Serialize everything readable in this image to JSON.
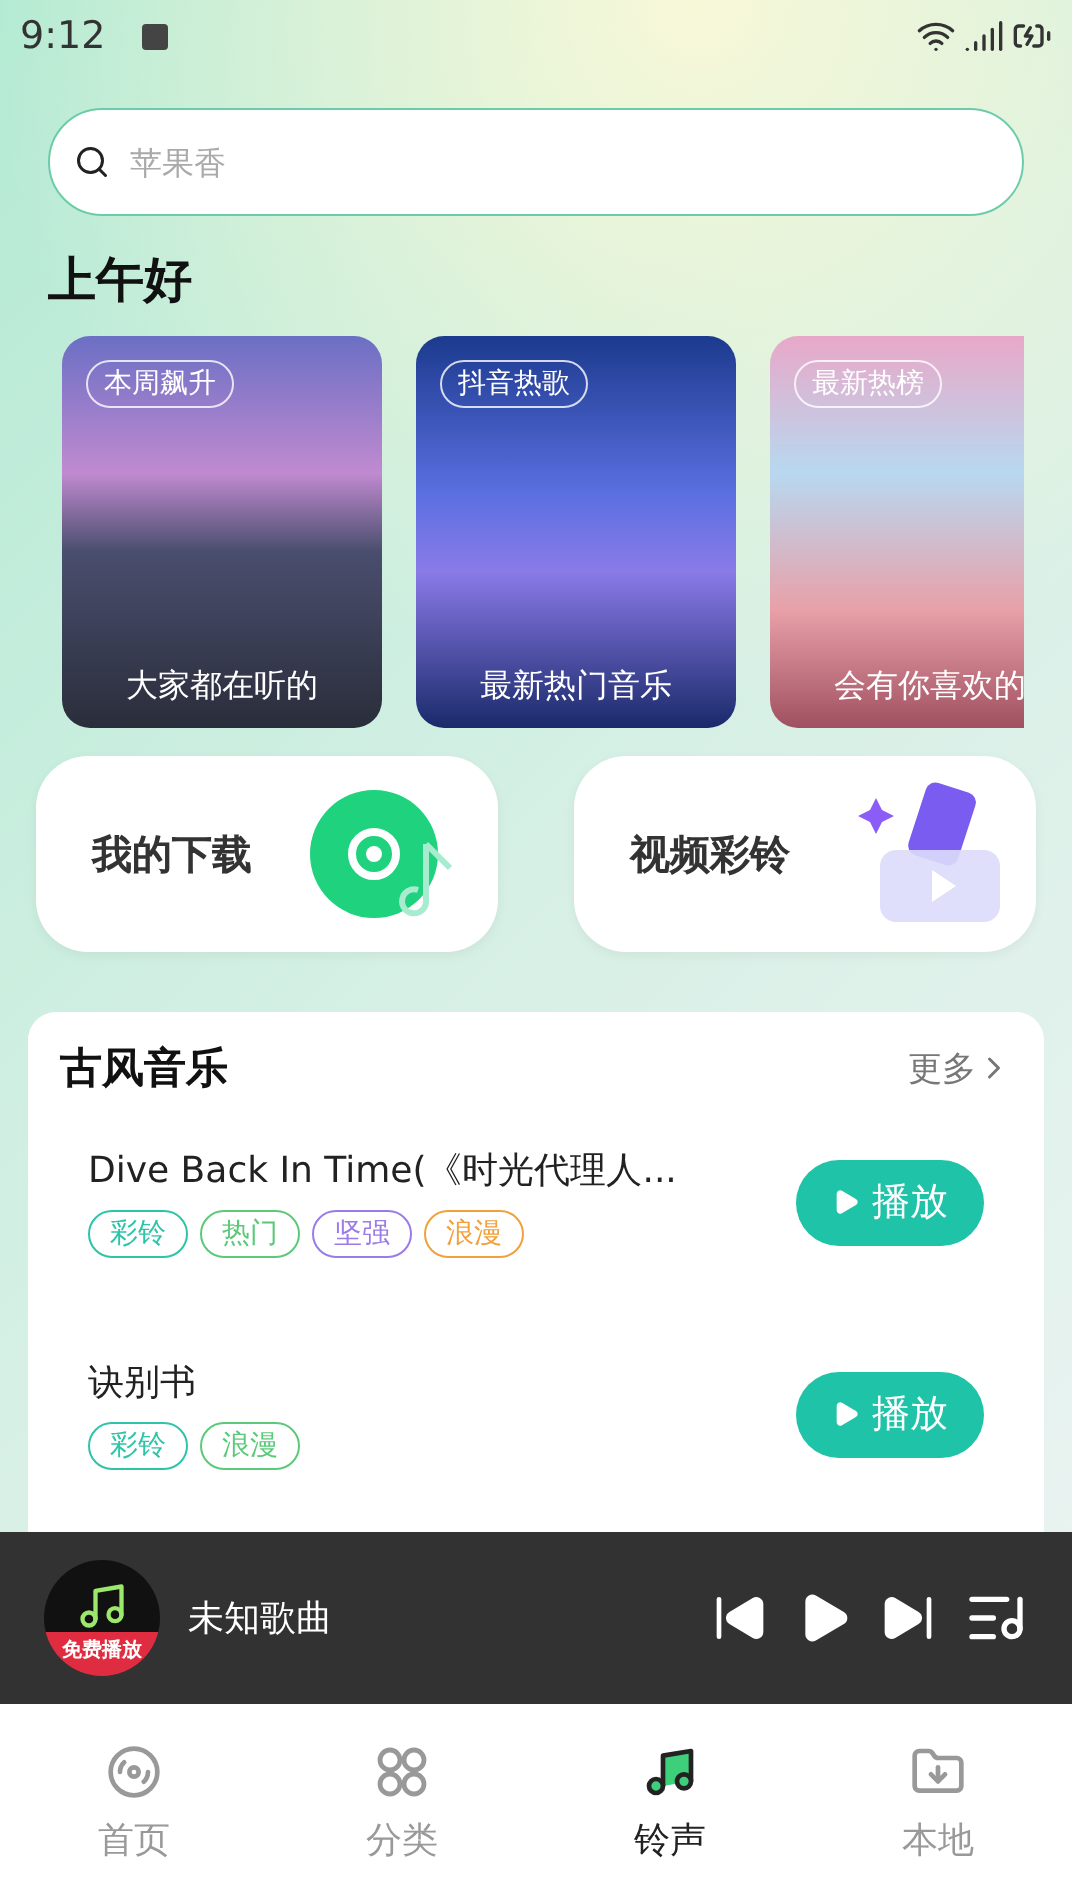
{
  "status_bar": {
    "time": "9:12"
  },
  "search": {
    "placeholder": "苹果香"
  },
  "greeting": "上午好",
  "banners": [
    {
      "badge": "本周飙升",
      "caption": "大家都在听的",
      "kind": "mountain"
    },
    {
      "badge": "抖音热歌",
      "caption": "最新热门音乐",
      "kind": "stage"
    },
    {
      "badge": "最新热榜",
      "caption": "会有你喜欢的",
      "kind": "pastel"
    }
  ],
  "shortcuts": [
    {
      "label": "我的下载",
      "kind": "download"
    },
    {
      "label": "视频彩铃",
      "kind": "video"
    }
  ],
  "section": {
    "title": "古风音乐",
    "more": "更多",
    "songs": [
      {
        "title": "Dive Back In Time(《时光代理人...",
        "button": "播放",
        "tags": [
          {
            "label": "彩铃",
            "color": "#2ec4a8"
          },
          {
            "label": "热门",
            "color": "#5cc97a"
          },
          {
            "label": "坚强",
            "color": "#9b7be8"
          },
          {
            "label": "浪漫",
            "color": "#f0a03c"
          }
        ]
      },
      {
        "title": "诀别书",
        "button": "播放",
        "tags": [
          {
            "label": "彩铃",
            "color": "#2ec4a8"
          },
          {
            "label": "浪漫",
            "color": "#5cc97a"
          }
        ]
      }
    ]
  },
  "player": {
    "badge": "免费播放",
    "title": "未知歌曲"
  },
  "nav": [
    {
      "label": "首页",
      "kind": "home",
      "selected": false
    },
    {
      "label": "分类",
      "kind": "category",
      "selected": false
    },
    {
      "label": "铃声",
      "kind": "ringtone",
      "selected": true
    },
    {
      "label": "本地",
      "kind": "local",
      "selected": false
    }
  ]
}
